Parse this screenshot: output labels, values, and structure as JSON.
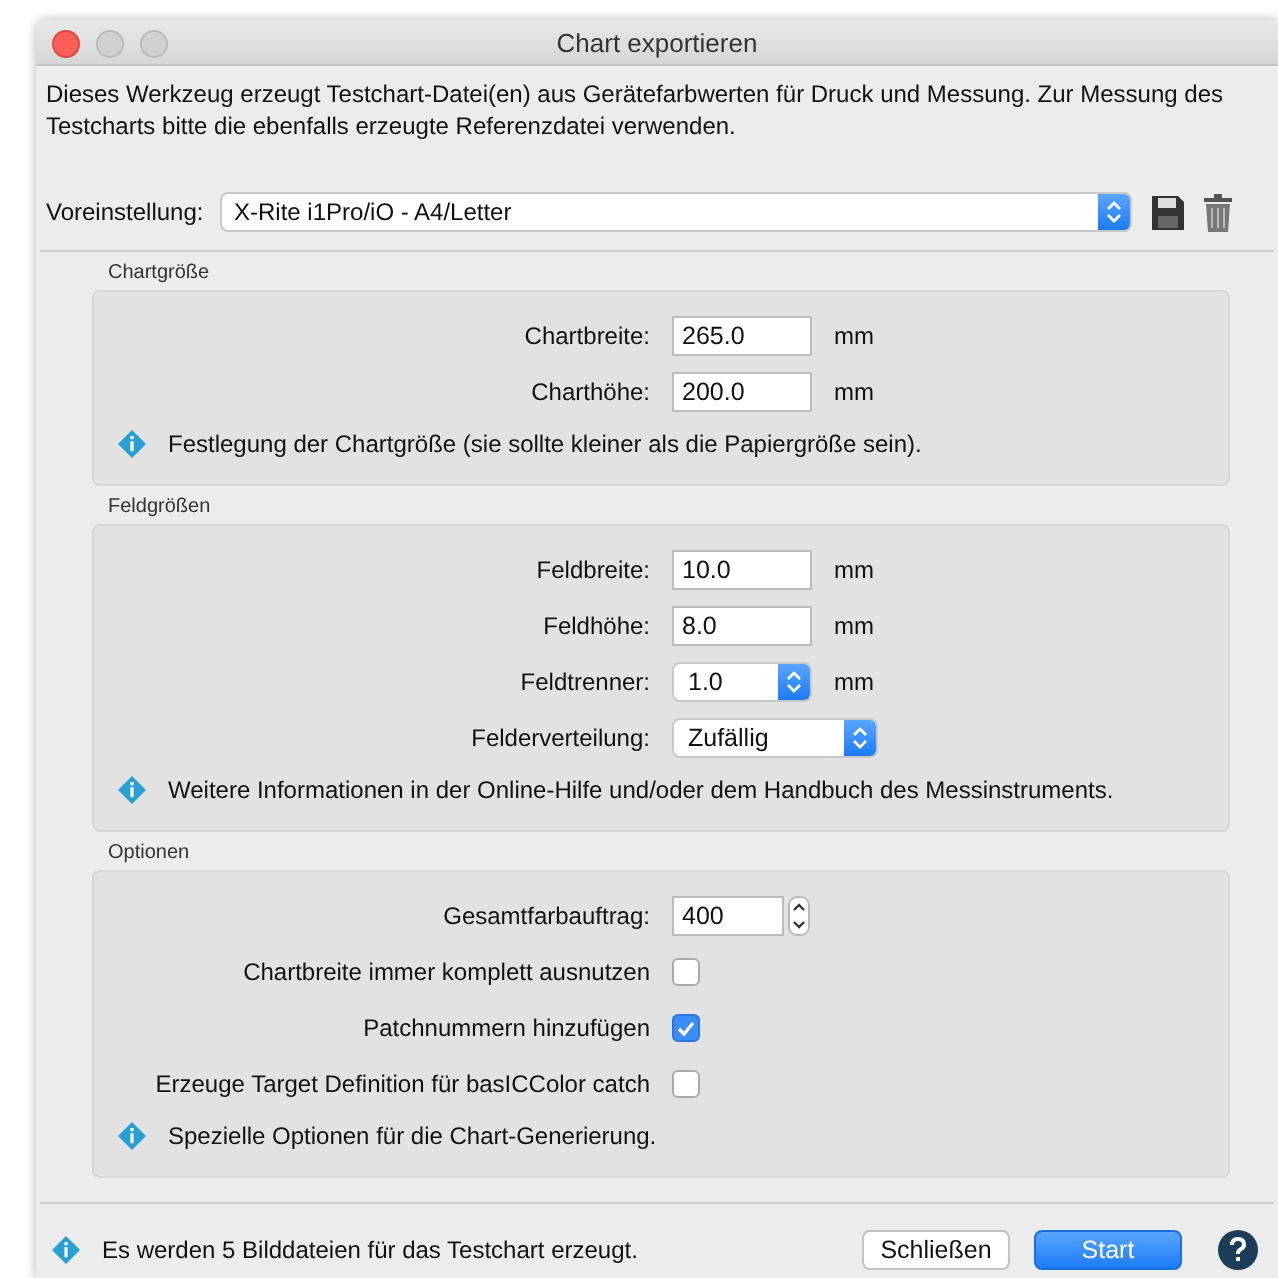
{
  "window": {
    "title": "Chart exportieren"
  },
  "description": "Dieses Werkzeug erzeugt Testchart-Datei(en) aus Gerätefarbwerten für Druck und Messung. Zur Messung des Testcharts bitte die ebenfalls erzeugte Referenzdatei verwenden.",
  "preset": {
    "label": "Voreinstellung:",
    "value": "X-Rite i1Pro/iO - A4/Letter"
  },
  "groups": [
    {
      "title": "Chartgröße",
      "rows": [
        {
          "kind": "text_field",
          "label": "Chartbreite:",
          "value": "265.0",
          "unit": "mm"
        },
        {
          "kind": "text_field",
          "label": "Charthöhe:",
          "value": "200.0",
          "unit": "mm"
        }
      ],
      "info": "Festlegung der Chartgröße (sie sollte kleiner als die Papiergröße sein)."
    },
    {
      "title": "Feldgrößen",
      "rows": [
        {
          "kind": "text_field",
          "label": "Feldbreite:",
          "value": "10.0",
          "unit": "mm"
        },
        {
          "kind": "text_field",
          "label": "Feldhöhe:",
          "value": "8.0",
          "unit": "mm"
        },
        {
          "kind": "dropdown",
          "label": "Feldtrenner:",
          "value": "1.0",
          "unit": "mm"
        },
        {
          "kind": "dropdown_wide",
          "label": "Felderverteilung:",
          "value": "Zufällig"
        }
      ],
      "info": "Weitere Informationen in der Online-Hilfe und/oder dem Handbuch des Messinstruments."
    },
    {
      "title": "Optionen",
      "rows": [
        {
          "kind": "stepper",
          "label": "Gesamtfarbauftrag:",
          "value": "400"
        },
        {
          "kind": "checkbox",
          "label": "Chartbreite immer komplett ausnutzen",
          "checked": false
        },
        {
          "kind": "checkbox",
          "label": "Patchnummern hinzufügen",
          "checked": true
        },
        {
          "kind": "checkbox",
          "label": "Erzeuge Target Definition für basICColor catch",
          "checked": false
        }
      ],
      "info": "Spezielle Optionen für die Chart-Generierung."
    }
  ],
  "footer": {
    "info": "Es werden 5 Bilddateien für das Testchart erzeugt.",
    "buttons": [
      {
        "label": "Schließen",
        "kind": "secondary"
      },
      {
        "label": "Start",
        "kind": "primary"
      }
    ]
  }
}
